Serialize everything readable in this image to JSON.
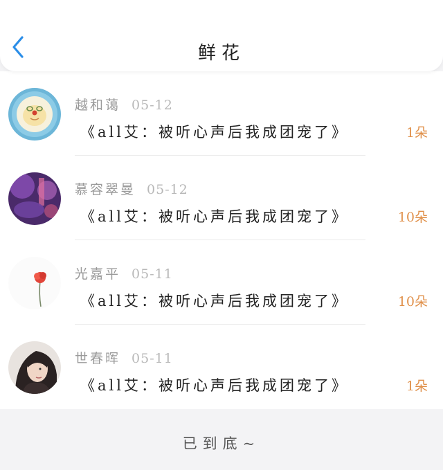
{
  "header": {
    "title": "鲜花",
    "back_icon": "chevron-left-icon",
    "accent_color": "#2b8ee8"
  },
  "records": [
    {
      "name": "越和蔼",
      "date": "05-12",
      "book": "《all艾：被听心声后我成团宠了》",
      "amount": "1朵",
      "avatar": "pudding-avatar"
    },
    {
      "name": "慕容翠曼",
      "date": "05-12",
      "book": "《all艾：被听心声后我成团宠了》",
      "amount": "10朵",
      "avatar": "purple-room-avatar"
    },
    {
      "name": "光嘉平",
      "date": "05-11",
      "book": "《all艾：被听心声后我成团宠了》",
      "amount": "10朵",
      "avatar": "red-flower-avatar"
    },
    {
      "name": "世春晖",
      "date": "05-11",
      "book": "《all艾：被听心声后我成团宠了》",
      "amount": "1朵",
      "avatar": "portrait-avatar"
    }
  ],
  "footer": {
    "end_text": "已到底~"
  },
  "colors": {
    "amount": "#e0904a",
    "name": "#9a9a9a",
    "page_bg": "#f3f3f5"
  }
}
